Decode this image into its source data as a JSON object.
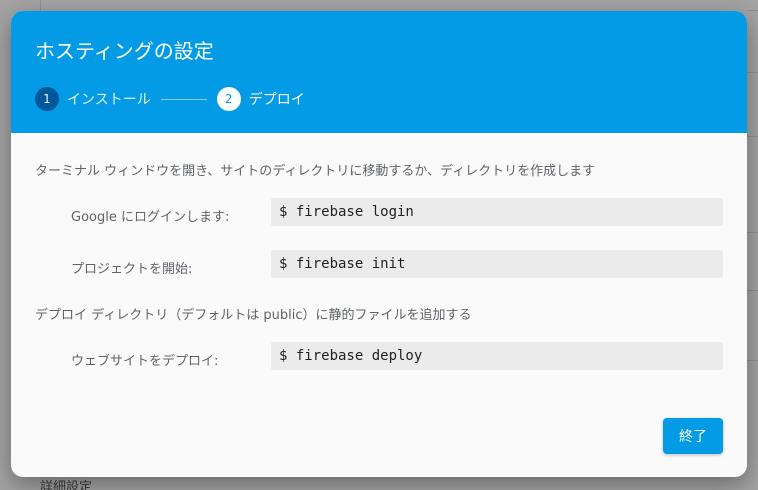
{
  "background": {
    "partial_text": "詳細設定"
  },
  "dialog": {
    "title": "ホスティングの設定",
    "steps": [
      {
        "number": "1",
        "label": "インストール",
        "state": "completed"
      },
      {
        "number": "2",
        "label": "デプロイ",
        "state": "active"
      }
    ],
    "instruction_1": "ターミナル ウィンドウを開き、サイトのディレクトリに移動するか、ディレクトリを作成します",
    "commands_1": [
      {
        "label": "Google にログインします:",
        "command": "$ firebase login"
      },
      {
        "label": "プロジェクトを開始:",
        "command": "$ firebase init"
      }
    ],
    "instruction_2": "デプロイ ディレクトリ（デフォルトは public）に静的ファイルを追加する",
    "commands_2": [
      {
        "label": "ウェブサイトをデプロイ:",
        "command": "$ firebase deploy"
      }
    ],
    "done_label": "終了"
  },
  "colors": {
    "accent": "#039be5",
    "step_completed": "#01579b",
    "overlay": "#9a9a9a"
  }
}
